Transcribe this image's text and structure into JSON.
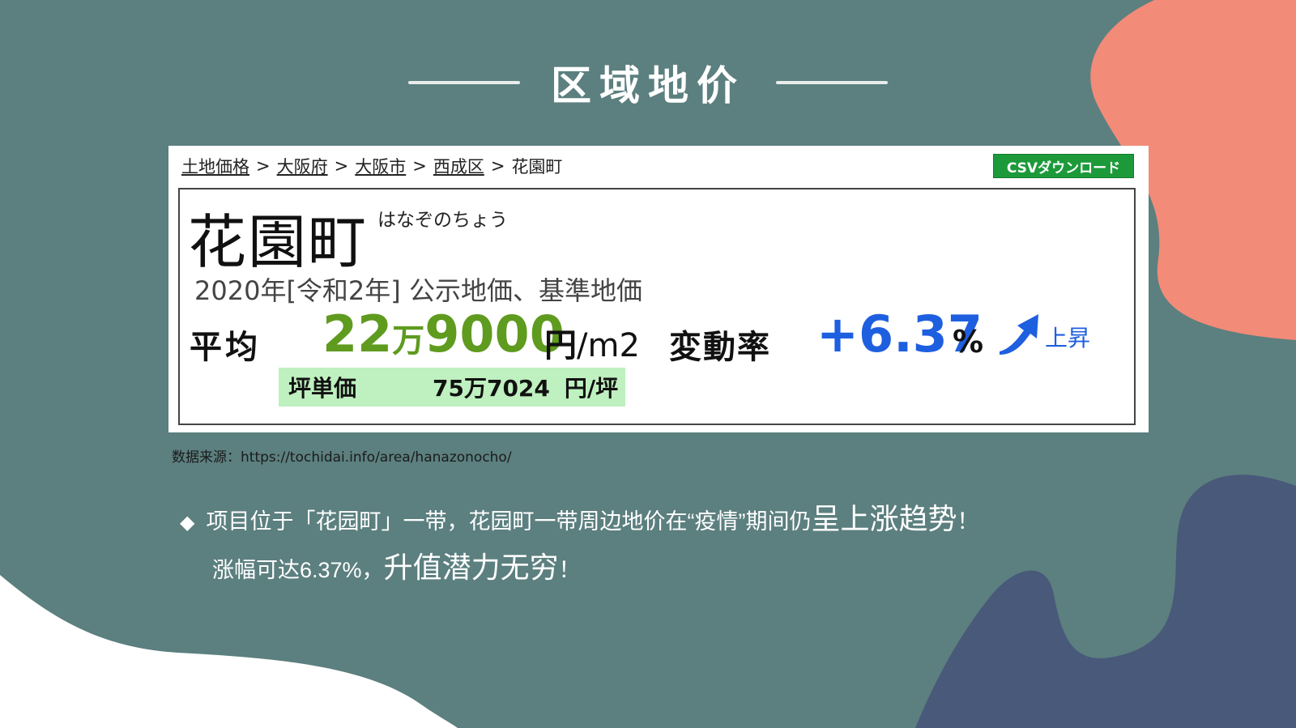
{
  "title": "区域地价",
  "breadcrumb": {
    "links": [
      "土地価格",
      "大阪府",
      "大阪市",
      "西成区"
    ],
    "separator": ">",
    "current": "花園町"
  },
  "csv_button": "CSVダウンロード",
  "town": {
    "name": "花園町",
    "kana": "はなぞのちょう",
    "year_line": "2020年[令和2年] 公示地価、基準地価"
  },
  "average": {
    "label": "平均",
    "price_part1": "22",
    "price_man": "万",
    "price_part2": "9000",
    "unit_yen": "円",
    "unit_area": "/m2"
  },
  "rate": {
    "label": "変動率",
    "value": "+6.37",
    "percent": "%",
    "trend": "上昇",
    "trend_icon": "up-arrow-icon",
    "trend_color": "#1e5fe0"
  },
  "tsubo": {
    "label": "坪単価",
    "value": "75万7024",
    "unit": "円/坪"
  },
  "source": "数据来源：https://tochidai.info/area/hanazonocho/",
  "bullets": {
    "marker": "◆",
    "line1_normal": "项目位于「花园町」一带，花园町一带周边地价在“疫情”期间仍",
    "line1_emph": "呈上涨趋势",
    "line1_end": "！",
    "line2_normal": "涨幅可达6.37%，",
    "line2_emph": "升值潜力无穷",
    "line2_end": "！"
  },
  "colors": {
    "background": "#5c7f7f",
    "accent_salmon": "#f28b78",
    "accent_navy": "#48597a",
    "price_green": "#5f9b1f",
    "rate_blue": "#1e5fe0",
    "csv_green": "#1c9a3a"
  }
}
